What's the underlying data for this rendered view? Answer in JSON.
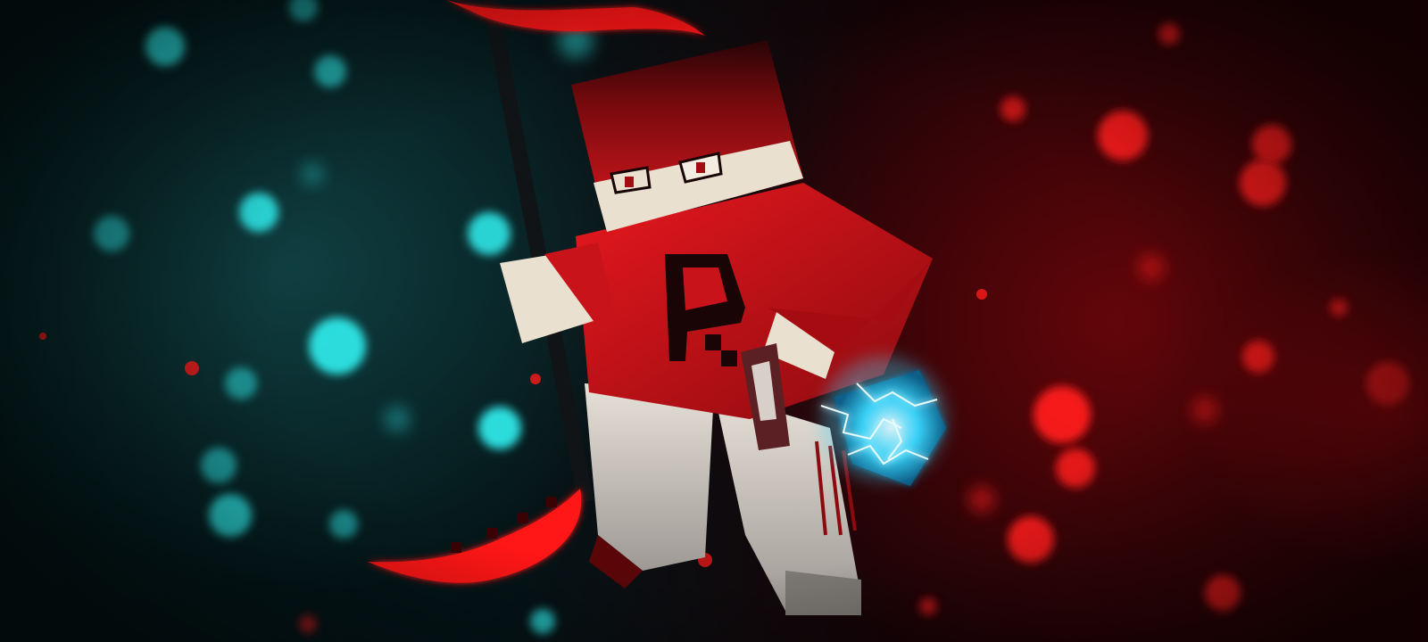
{
  "scene": {
    "type": "minecraft-style character render",
    "character": {
      "skin_colors": {
        "hood": "#d4141a",
        "hood_shadow": "#7a0a0e",
        "face": "#e9e0cf",
        "shirt": "#c8131a",
        "pants": "#d9d4cc",
        "logo_letter": "#1a0506"
      },
      "shirt_logo_letter": "R"
    },
    "weapon": {
      "type": "scythe",
      "blade_color": "#ff1418",
      "handle_color": "#101416"
    },
    "held_item": {
      "type": "lightning-orb",
      "color": "#3ad8ff"
    },
    "palette": {
      "left_glow": "#2ee6e6",
      "right_glow": "#ff1a1a",
      "background_left": "#041417",
      "background_right": "#2a0306"
    }
  }
}
